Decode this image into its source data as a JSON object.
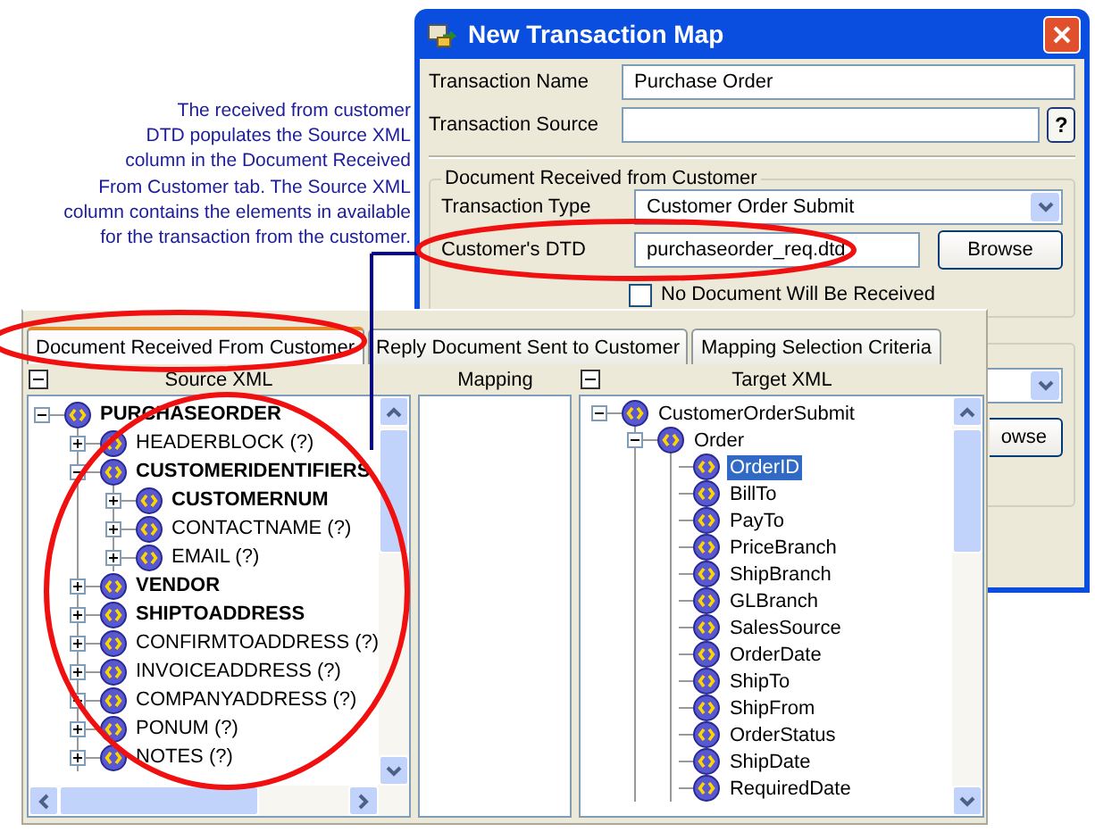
{
  "annotation": {
    "lines": [
      "The received from customer",
      "DTD populates the Source XML",
      "column in the Document Received",
      "From Customer tab. The Source XML",
      "column contains the elements in available",
      "for the transaction from the customer."
    ]
  },
  "dialog": {
    "title": "New Transaction Map",
    "transaction_name": {
      "label": "Transaction Name",
      "value": "Purchase Order"
    },
    "transaction_source": {
      "label": "Transaction Source",
      "help_button": "?"
    },
    "group": {
      "legend": "Document Received from Customer",
      "transaction_type": {
        "label": "Transaction Type",
        "value": "Customer Order Submit"
      },
      "customers_dtd": {
        "label": "Customer's DTD",
        "value": "purchaseorder_req.dtd",
        "button": "Browse"
      },
      "no_document": {
        "label": "No Document Will Be Received",
        "checked": false
      }
    },
    "group_2": {
      "button": "owse"
    }
  },
  "mapping_window": {
    "tabs": [
      {
        "label": "Document Received From Customer",
        "selected": true
      },
      {
        "label": "Reply Document Sent to Customer",
        "selected": false
      },
      {
        "label": "Mapping Selection Criteria",
        "selected": false
      }
    ],
    "source": {
      "title": "Source XML",
      "tree": [
        {
          "label": "PURCHASEORDER",
          "bold": true,
          "expanded": true,
          "selected": false,
          "children": [
            {
              "label": "HEADERBLOCK (?)",
              "bold": false,
              "expanded": false,
              "selected": false
            },
            {
              "label": "CUSTOMERIDENTIFIERS",
              "bold": true,
              "expanded": true,
              "selected": false,
              "children": [
                {
                  "label": "CUSTOMERNUM",
                  "bold": true,
                  "expanded": false,
                  "selected": false
                },
                {
                  "label": "CONTACTNAME (?)",
                  "bold": false,
                  "expanded": false,
                  "selected": false
                },
                {
                  "label": "EMAIL (?)",
                  "bold": false,
                  "expanded": false,
                  "selected": false
                }
              ]
            },
            {
              "label": "VENDOR",
              "bold": true,
              "expanded": false,
              "selected": false
            },
            {
              "label": "SHIPTOADDRESS",
              "bold": true,
              "expanded": false,
              "selected": false
            },
            {
              "label": "CONFIRMTOADDRESS (?)",
              "bold": false,
              "expanded": false,
              "selected": false
            },
            {
              "label": "INVOICEADDRESS (?)",
              "bold": false,
              "expanded": false,
              "selected": false
            },
            {
              "label": "COMPANYADDRESS (?)",
              "bold": false,
              "expanded": false,
              "selected": false
            },
            {
              "label": "PONUM (?)",
              "bold": false,
              "expanded": false,
              "selected": false
            },
            {
              "label": "NOTES (?)",
              "bold": false,
              "expanded": false,
              "selected": false
            }
          ]
        }
      ]
    },
    "mapping": {
      "title": "Mapping"
    },
    "target": {
      "title": "Target XML",
      "tree": [
        {
          "label": "CustomerOrderSubmit",
          "expanded": true,
          "selected": false,
          "children": [
            {
              "label": "Order",
              "expanded": true,
              "selected": false,
              "children": [
                {
                  "label": "OrderID",
                  "selected": true
                },
                {
                  "label": "BillTo",
                  "selected": false
                },
                {
                  "label": "PayTo",
                  "selected": false
                },
                {
                  "label": "PriceBranch",
                  "selected": false
                },
                {
                  "label": "ShipBranch",
                  "selected": false
                },
                {
                  "label": "GLBranch",
                  "selected": false
                },
                {
                  "label": "SalesSource",
                  "selected": false
                },
                {
                  "label": "OrderDate",
                  "selected": false
                },
                {
                  "label": "ShipTo",
                  "selected": false
                },
                {
                  "label": "ShipFrom",
                  "selected": false
                },
                {
                  "label": "OrderStatus",
                  "selected": false
                },
                {
                  "label": "ShipDate",
                  "selected": false
                },
                {
                  "label": "RequiredDate",
                  "selected": false
                }
              ]
            }
          ]
        }
      ]
    }
  }
}
